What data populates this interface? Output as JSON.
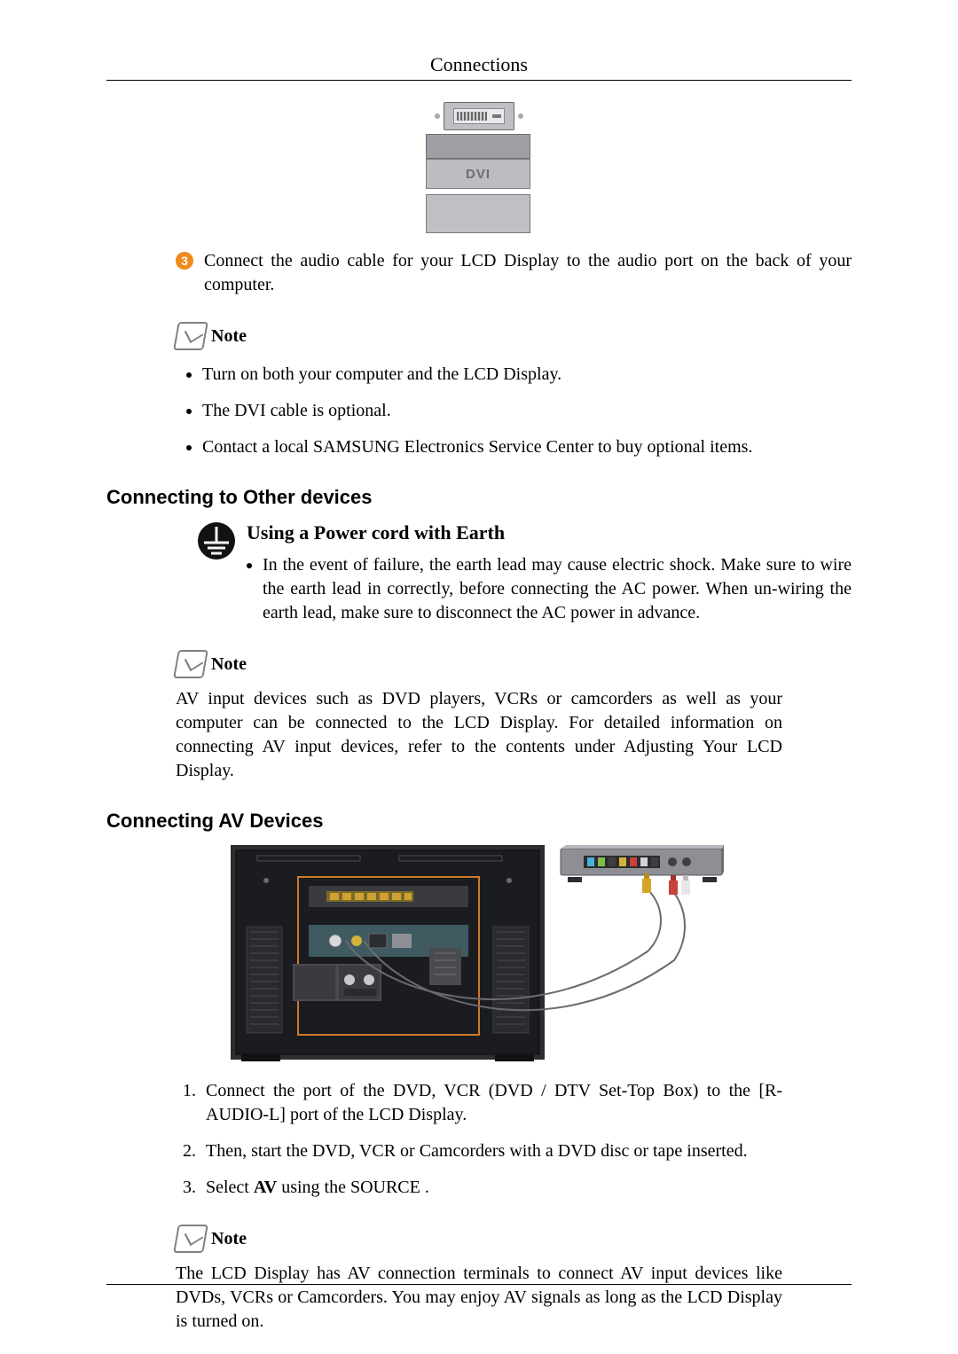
{
  "header": "Connections",
  "dvi_label": "DVI",
  "step3": {
    "num": "3",
    "text": "Connect the audio cable for your LCD Display to the audio port on the back of your computer."
  },
  "note_label": "Note",
  "note1": {
    "items": [
      "Turn on both your computer and the LCD Display.",
      "The DVI cable is optional.",
      "Contact a local SAMSUNG Electronics Service Center to buy optional items."
    ]
  },
  "section_other": "Connecting to Other devices",
  "earth": {
    "title": "Using a Power cord with Earth",
    "body": "In the event of failure, the earth lead may cause electric shock. Make sure to wire the earth lead in correctly, before connecting the AC power. When un-wiring the earth lead, make sure to disconnect the AC power in advance."
  },
  "note2": {
    "text": "AV input devices such as DVD players, VCRs or camcorders as well as your computer can be connected to the LCD Display. For detailed information on connecting AV input devices, refer to the contents under Adjusting Your LCD Display."
  },
  "section_av": "Connecting AV Devices",
  "ol": {
    "i1": "Connect the port of the DVD, VCR (DVD / DTV Set-Top Box) to the [R-AUDIO-L] port of the LCD Display.",
    "i2": "Then, start the DVD, VCR or Camcorders with a DVD disc or tape inserted.",
    "i3_pre": "Select ",
    "i3_bold": "AV",
    "i3_post": " using the SOURCE ."
  },
  "note3": {
    "text": "The LCD Display has AV connection terminals to connect AV input devices like DVDs, VCRs or Camcorders. You may enjoy AV signals as long as the LCD Display is turned on."
  }
}
